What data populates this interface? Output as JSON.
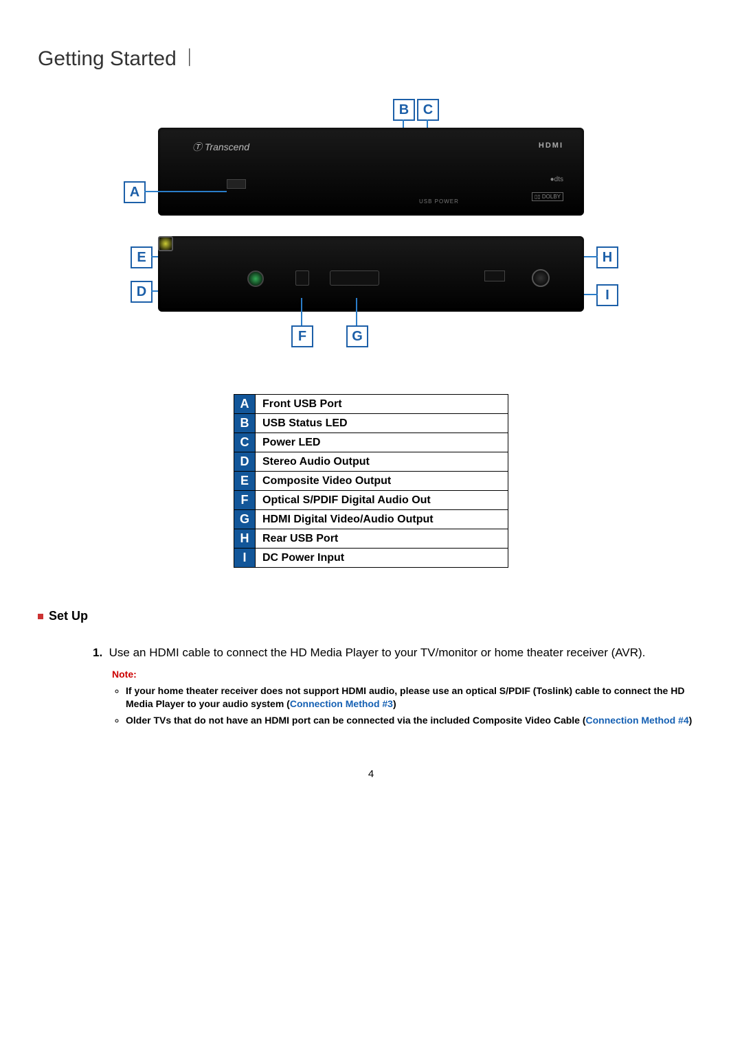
{
  "title": "Getting Started",
  "diagram": {
    "brand": "Transcend",
    "hdmi": "HDMI",
    "dts": "dts",
    "dolby": "DOLBY",
    "usb_power": "USB  POWER",
    "tags": [
      "A",
      "B",
      "C",
      "D",
      "E",
      "F",
      "G",
      "H",
      "I"
    ]
  },
  "legend": [
    {
      "letter": "A",
      "desc": "Front USB Port"
    },
    {
      "letter": "B",
      "desc": "USB Status LED"
    },
    {
      "letter": "C",
      "desc": "Power LED"
    },
    {
      "letter": "D",
      "desc": "Stereo Audio Output"
    },
    {
      "letter": "E",
      "desc": "Composite Video Output"
    },
    {
      "letter": "F",
      "desc": "Optical S/PDIF Digital Audio Out"
    },
    {
      "letter": "G",
      "desc": "HDMI Digital Video/Audio Output"
    },
    {
      "letter": "H",
      "desc": "Rear USB Port"
    },
    {
      "letter": "I",
      "desc": "DC Power Input"
    }
  ],
  "section": {
    "title": "Set Up"
  },
  "steps": [
    {
      "num": "1.",
      "text": "Use an HDMI cable to connect the HD Media Player to your TV/monitor or home theater receiver (AVR).",
      "note_label": "Note:",
      "notes": [
        {
          "pre": "If your home theater receiver does not support HDMI audio, please use an optical S/PDIF (Toslink) cable to connect the HD Media Player to your audio system (",
          "link": "Connection Method #3",
          "post": ")"
        },
        {
          "pre": "Older TVs that do not have an HDMI port can be connected via the included Composite Video Cable (",
          "link": "Connection Method #4",
          "post": ")"
        }
      ]
    }
  ],
  "page_number": "4"
}
